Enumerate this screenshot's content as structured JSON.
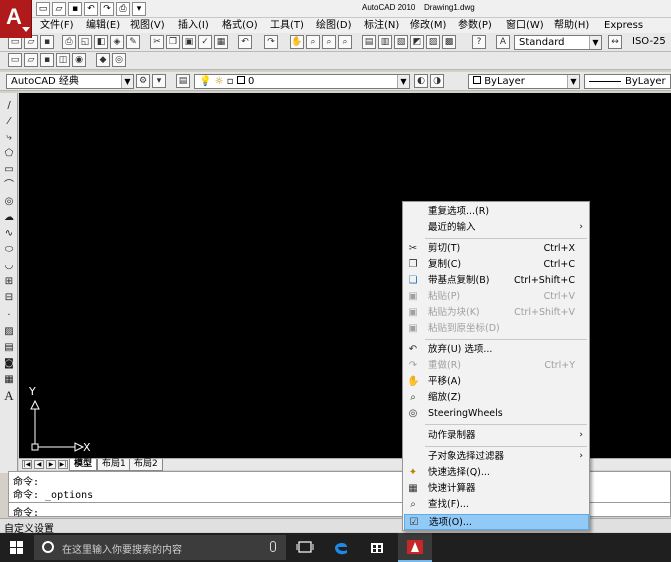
{
  "title_bar": {
    "app_title": "AutoCAD 2010",
    "doc_title": "Drawing1.dwg",
    "quick_access": [
      "new-icon",
      "open-icon",
      "save-icon",
      "undo-icon",
      "redo-icon",
      "print-icon",
      "dropdown-icon"
    ]
  },
  "menu_bar": {
    "items": [
      {
        "label": "文件(F)"
      },
      {
        "label": "编辑(E)"
      },
      {
        "label": "视图(V)"
      },
      {
        "label": "插入(I)"
      },
      {
        "label": "格式(O)"
      },
      {
        "label": "工具(T)"
      },
      {
        "label": "绘图(D)"
      },
      {
        "label": "标注(N)"
      },
      {
        "label": "修改(M)"
      },
      {
        "label": "参数(P)"
      },
      {
        "label": "窗口(W)"
      },
      {
        "label": "帮助(H)"
      },
      {
        "label": "Express"
      }
    ]
  },
  "toolbar1": {
    "text_style": "Standard",
    "dim_style": "ISO-25"
  },
  "toolbar2": {
    "workspace": "AutoCAD 经典"
  },
  "toolbar3": {
    "layer": "0",
    "color": "ByLayer",
    "linetype": "ByLayer"
  },
  "draw_tools": [
    "line-icon",
    "construction-line-icon",
    "polyline-icon",
    "polygon-icon",
    "rectangle-icon",
    "arc-icon",
    "circle-icon",
    "revision-cloud-icon",
    "spline-icon",
    "ellipse-icon",
    "ellipse-arc-icon",
    "insert-block-icon",
    "make-block-icon",
    "point-icon",
    "hatch-icon",
    "gradient-icon",
    "region-icon",
    "table-icon",
    "mtext-icon"
  ],
  "ucs": {
    "x_label": "X",
    "y_label": "Y"
  },
  "layout_tabs": {
    "tabs": [
      {
        "label": "模型",
        "active": true
      },
      {
        "label": "布局1",
        "active": false
      },
      {
        "label": "布局2",
        "active": false
      }
    ]
  },
  "command_window": {
    "history": [
      "命令:",
      "命令: _options"
    ],
    "prompt": "命令:"
  },
  "status_bar": {
    "text": "自定义设置"
  },
  "taskbar": {
    "search_placeholder": "在这里输入你要搜索的内容"
  },
  "context_menu": {
    "items": [
      {
        "label": "重复选项...(R)",
        "shortcut": "",
        "icon": "",
        "disabled": false,
        "submenu": false
      },
      {
        "label": "最近的输入",
        "shortcut": "",
        "icon": "",
        "disabled": false,
        "submenu": true
      },
      {
        "label": "剪切(T)",
        "shortcut": "Ctrl+X",
        "icon": "scissors-icon",
        "disabled": false,
        "submenu": false
      },
      {
        "label": "复制(C)",
        "shortcut": "Ctrl+C",
        "icon": "copy-icon",
        "disabled": false,
        "submenu": false
      },
      {
        "label": "带基点复制(B)",
        "shortcut": "Ctrl+Shift+C",
        "icon": "copy-base-icon",
        "disabled": false,
        "submenu": false
      },
      {
        "label": "粘贴(P)",
        "shortcut": "Ctrl+V",
        "icon": "paste-icon",
        "disabled": true,
        "submenu": false
      },
      {
        "label": "粘贴为块(K)",
        "shortcut": "Ctrl+Shift+V",
        "icon": "paste-block-icon",
        "disabled": true,
        "submenu": false
      },
      {
        "label": "粘贴到原坐标(D)",
        "shortcut": "",
        "icon": "paste-original-icon",
        "disabled": true,
        "submenu": false
      },
      {
        "label": "放弃(U) 选项...",
        "shortcut": "",
        "icon": "undo-icon",
        "disabled": false,
        "submenu": false
      },
      {
        "label": "重做(R)",
        "shortcut": "Ctrl+Y",
        "icon": "redo-icon",
        "disabled": true,
        "submenu": false
      },
      {
        "label": "平移(A)",
        "shortcut": "",
        "icon": "pan-icon",
        "disabled": false,
        "submenu": false
      },
      {
        "label": "缩放(Z)",
        "shortcut": "",
        "icon": "zoom-icon",
        "disabled": false,
        "submenu": false
      },
      {
        "label": "SteeringWheels",
        "shortcut": "",
        "icon": "steering-wheel-icon",
        "disabled": false,
        "submenu": false
      },
      {
        "label": "动作录制器",
        "shortcut": "",
        "icon": "",
        "disabled": false,
        "submenu": true
      },
      {
        "label": "子对象选择过滤器",
        "shortcut": "",
        "icon": "",
        "disabled": false,
        "submenu": true
      },
      {
        "label": "快速选择(Q)...",
        "shortcut": "",
        "icon": "quick-select-icon",
        "disabled": false,
        "submenu": false
      },
      {
        "label": "快速计算器",
        "shortcut": "",
        "icon": "calculator-icon",
        "disabled": false,
        "submenu": false
      },
      {
        "label": "查找(F)...",
        "shortcut": "",
        "icon": "find-icon",
        "disabled": false,
        "submenu": false
      },
      {
        "label": "选项(O)...",
        "shortcut": "",
        "icon": "options-icon",
        "disabled": false,
        "submenu": false,
        "highlighted": true
      }
    ]
  }
}
